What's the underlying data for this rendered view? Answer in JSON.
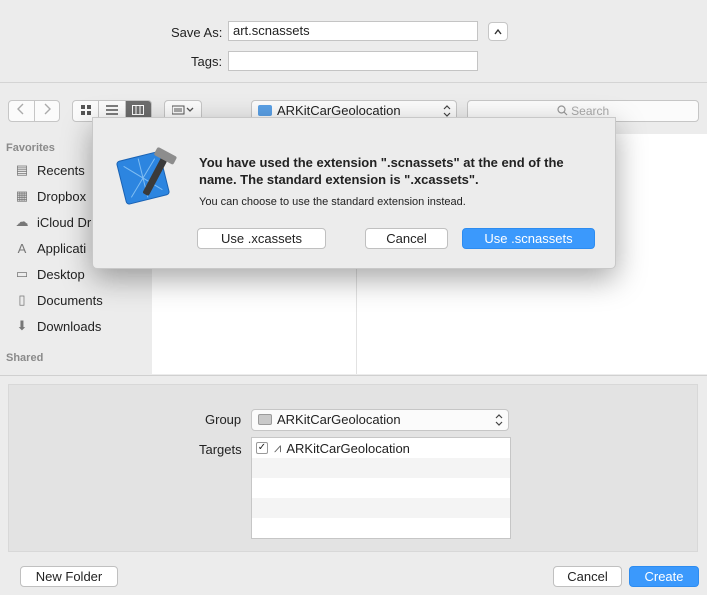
{
  "save_as": {
    "label": "Save As:",
    "value": "art.scnassets"
  },
  "tags": {
    "label": "Tags:",
    "value": ""
  },
  "toolbar": {
    "location": "ARKitCarGeolocation",
    "search_placeholder": "Search"
  },
  "sidebar": {
    "favorites_header": "Favorites",
    "items": [
      {
        "label": "Recents",
        "icon": "recents-icon"
      },
      {
        "label": "Dropbox",
        "icon": "dropbox-icon"
      },
      {
        "label": "iCloud Dr",
        "icon": "icloud-icon"
      },
      {
        "label": "Applicati",
        "icon": "applications-icon"
      },
      {
        "label": "Desktop",
        "icon": "desktop-icon"
      },
      {
        "label": "Documents",
        "icon": "documents-icon"
      },
      {
        "label": "Downloads",
        "icon": "downloads-icon"
      }
    ],
    "shared_header": "Shared"
  },
  "dialog": {
    "title": "You have used the extension \".scnassets\" at the end of the name. The standard extension is \".xcassets\".",
    "message": "You can choose to use the standard extension instead.",
    "btn_xcassets": "Use .xcassets",
    "btn_cancel": "Cancel",
    "btn_scnassets": "Use .scnassets"
  },
  "options": {
    "group_label": "Group",
    "group_value": "ARKitCarGeolocation",
    "targets_label": "Targets",
    "target_name": "ARKitCarGeolocation",
    "target_checked": true
  },
  "footer": {
    "new_folder": "New Folder",
    "cancel": "Cancel",
    "create": "Create"
  },
  "colors": {
    "accent": "#3b99fc",
    "window_bg": "#ececec"
  }
}
